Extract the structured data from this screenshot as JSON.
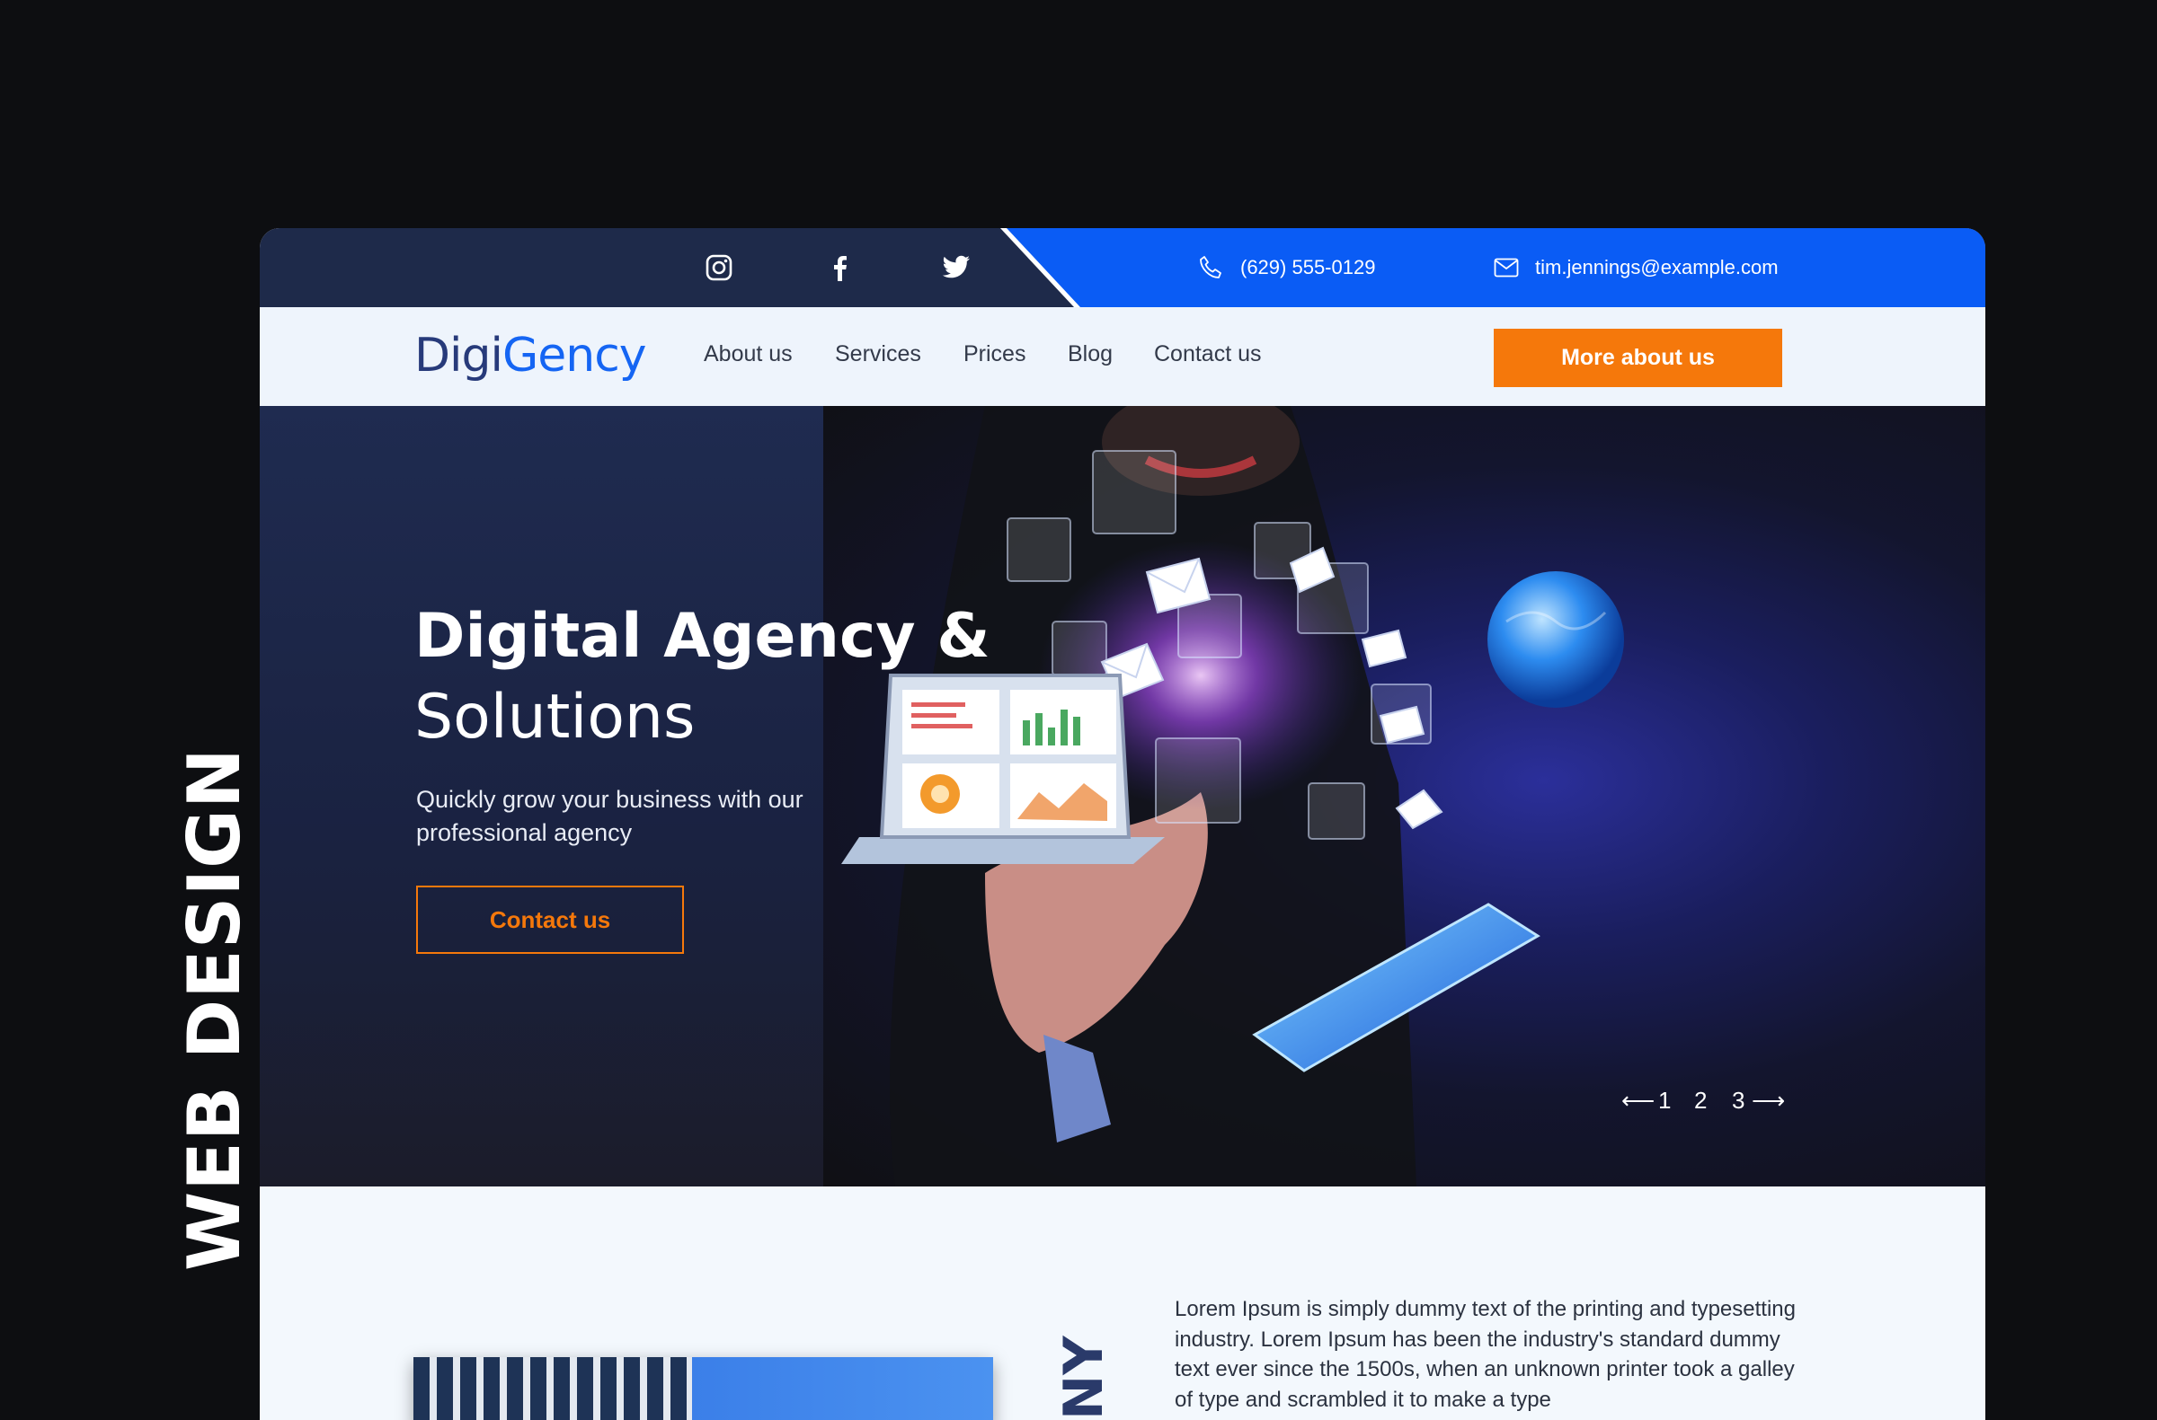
{
  "side_label": "WEB DESIGN",
  "topbar": {
    "social": [
      "instagram-icon",
      "facebook-icon",
      "twitter-icon"
    ],
    "phone": "(629) 555-0129",
    "email": "tim.jennings@example.com"
  },
  "nav": {
    "logo_part1": "Digi",
    "logo_part2": "Gency",
    "links": [
      "About us",
      "Services",
      "Prices",
      "Blog",
      "Contact us"
    ],
    "cta": "More about us"
  },
  "hero": {
    "title_line1": "Digital Agency &",
    "title_line2": "Solutions",
    "subtitle": "Quickly grow your business with our professional agency",
    "button": "Contact us",
    "pager": {
      "prev": "⟵",
      "pages": [
        "1",
        "2",
        "3"
      ],
      "next": "⟶"
    }
  },
  "section": {
    "vertical_word": "NY",
    "paragraph": "Lorem Ipsum is simply dummy text of the printing and typesetting industry. Lorem Ipsum has been the industry's standard dummy text ever since the 1500s, when an unknown printer took a galley of type and scrambled it to make a type"
  },
  "colors": {
    "accent_orange": "#f5780b",
    "brand_blue": "#0a5cf5",
    "navy": "#1e2a4a"
  }
}
